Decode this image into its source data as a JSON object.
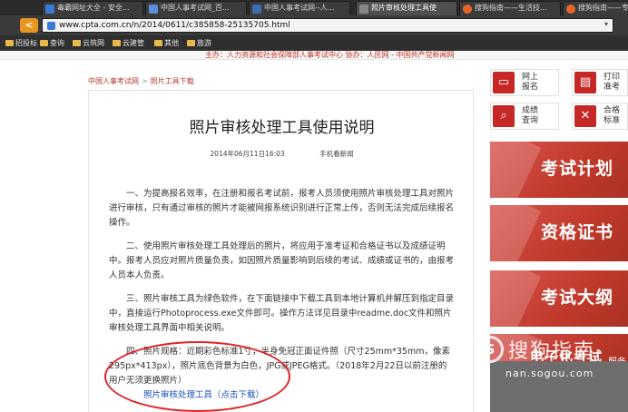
{
  "tabs": [
    {
      "label": "毒霸网址大全 - 安全...",
      "color": "#3a7bd5"
    },
    {
      "label": "中国人事考试网_百...",
      "color": "#5a8fd8"
    },
    {
      "label": "中国人事考试网--人...",
      "color": "#3d6bb3"
    },
    {
      "label": "照片审核处理工具使",
      "color": "#888888"
    },
    {
      "label": "搜狗指南——生活技...",
      "color": "#e8662a"
    },
    {
      "label": "搜狗指南——专",
      "color": "#e8662a"
    }
  ],
  "address": {
    "back": "<",
    "url": "www.cpta.com.cn/n/2014/0611/c385858-25135705.html"
  },
  "bookmarks": [
    "招投标",
    "查询",
    "云筑网",
    "云建管",
    "其他",
    "旅游"
  ],
  "page": {
    "footer": "主办：人力资源和社会保障部人事考试中心   协办：人民网 - 中国共产党新闻网",
    "breadcrumb": {
      "home": "中国人事考试网",
      "sep": ">",
      "current": "照片工具下载"
    },
    "title": "照片审核处理工具使用说明",
    "meta": {
      "date": "2014年06月11日16:03",
      "mobile": "手机看新闻"
    },
    "paragraphs": [
      "一、为提高报名效率，在注册和报名考试前，报考人员须使用照片审核处理工具对照片进行审核，只有通过审核的照片才能被网报系统识别进行正常上传，否则无法完成后续报名操作。",
      "二、使用照片审核处理工具处理后的照片，将应用于准考证和合格证书以及成绩证明中。报考人员应对照片质量负责，如因照片质量影响到后续的考试、成绩或证书的，由报考人员本人负责。",
      "三、照片审核工具为绿色软件，在下面链接中下载工具到本地计算机并解压到指定目录中，直接运行Photoprocess.exe文件即可。操作方法详见目录中readme.doc文件和照片审核处理工具界面中相关说明。",
      "四、照片规格：近期彩色标准1寸，半身免冠正面证件照（尺寸25mm*35mm，像素295px*413px），照片底色背景为白色，JPG或JPEG格式。（2018年2月22日以前注册的用户无须更换照片）"
    ],
    "download": "照片审核处理工具（点击下载）"
  },
  "sidebar": {
    "buttons": [
      {
        "label": "网上\n报名",
        "icon": "monitor-icon",
        "glyph": "▭"
      },
      {
        "label": "打印\n准考",
        "icon": "printer-icon",
        "glyph": "▤"
      },
      {
        "label": "成绩\n查询",
        "icon": "search-doc-icon",
        "glyph": "⌕"
      },
      {
        "label": "合格\n标准",
        "icon": "tools-icon",
        "glyph": "✕"
      }
    ],
    "banners": [
      "考试计划",
      "资格证书",
      "考试大纲",
      "电子化考试"
    ],
    "watermark": {
      "logo": "S",
      "title": "搜狗指南",
      "url": "nan.sogou.com"
    },
    "extra": "服务"
  },
  "colors": {
    "accent": "#c0392b",
    "link": "#1a4fbf",
    "annotation": "#e02424"
  }
}
